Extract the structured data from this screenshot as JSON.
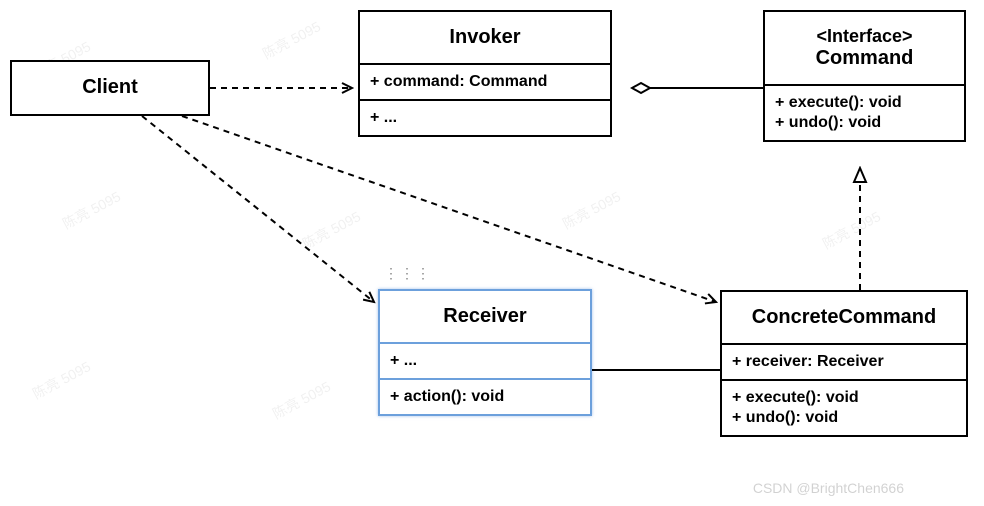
{
  "classes": {
    "client": {
      "name": "Client"
    },
    "invoker": {
      "name": "Invoker",
      "attr1": "+ command: Command",
      "attr2": "+ ..."
    },
    "command": {
      "stereotype": "<Interface>",
      "name": "Command",
      "op1": "+ execute(): void",
      "op2": "+ undo(): void"
    },
    "receiver": {
      "name": "Receiver",
      "attr1": "+ ...",
      "op1": "+ action(): void"
    },
    "concrete": {
      "name": "ConcreteCommand",
      "attr1": "+ receiver: Receiver",
      "op1": "+ execute(): void",
      "op2": "+ undo(): void"
    }
  },
  "relationships": [
    {
      "from": "Client",
      "to": "Invoker",
      "type": "dependency",
      "arrow": "open"
    },
    {
      "from": "Client",
      "to": "Receiver",
      "type": "dependency",
      "arrow": "open"
    },
    {
      "from": "Client",
      "to": "ConcreteCommand",
      "type": "dependency",
      "arrow": "open"
    },
    {
      "from": "Invoker",
      "to": "Command",
      "type": "aggregation",
      "arrow": "diamond"
    },
    {
      "from": "ConcreteCommand",
      "to": "Command",
      "type": "realization",
      "arrow": "triangle"
    },
    {
      "from": "ConcreteCommand",
      "to": "Receiver",
      "type": "association",
      "arrow": "none"
    }
  ],
  "watermark_text": "陈亮 5095",
  "bottom_watermark": "CSDN @BrightChen666"
}
